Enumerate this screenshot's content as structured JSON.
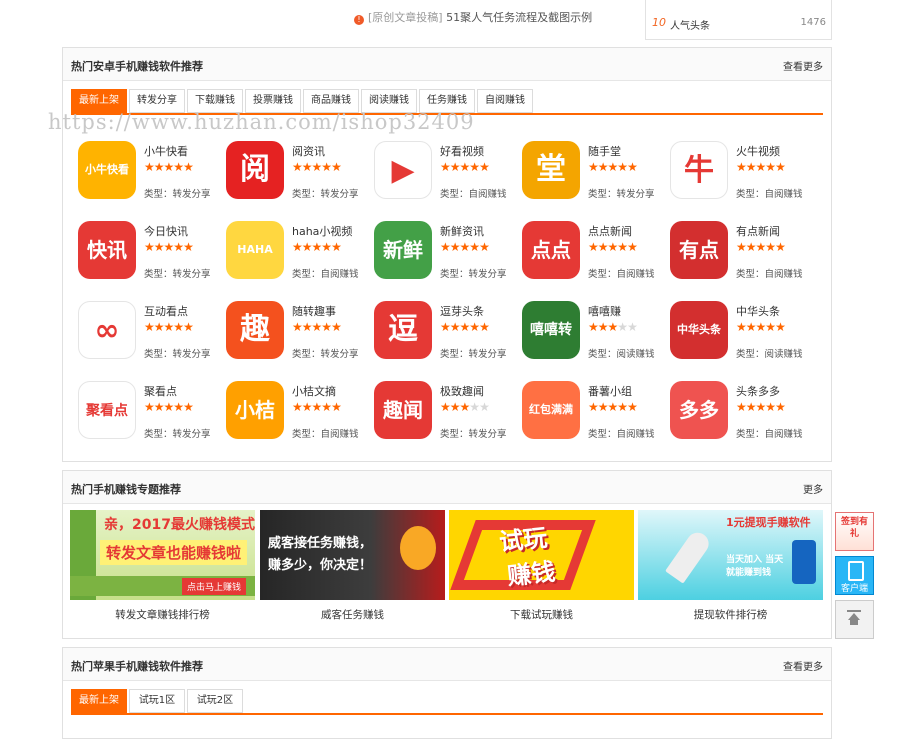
{
  "top": {
    "article_icon": "info-icon",
    "article_tag": "[原创文章投稿]",
    "article_title": "51聚人气任务流程及截图示例",
    "rank_num": "10",
    "rank_label": "人气头条",
    "rank_count": "1476"
  },
  "watermark": "https://www.huzhan.com/ishop32409",
  "android": {
    "title": "热门安卓手机赚钱软件推荐",
    "more": "查看更多",
    "tabs": [
      "最新上架",
      "转发分享",
      "下载赚钱",
      "投票赚钱",
      "商品赚钱",
      "阅读赚钱",
      "任务赚钱",
      "自阅赚钱"
    ],
    "apps": [
      {
        "name": "小牛快看",
        "rating": 5,
        "type": "类型：转发分享",
        "icon_text": "小牛快看",
        "color": "#ffb300"
      },
      {
        "name": "阅资讯",
        "rating": 5,
        "type": "类型：转发分享",
        "icon_text": "阅",
        "color": "#e52222"
      },
      {
        "name": "好看视频",
        "rating": 5,
        "type": "类型：自阅赚钱",
        "icon_text": "▶",
        "color": "#ffffff"
      },
      {
        "name": "随手堂",
        "rating": 5,
        "type": "类型：转发分享",
        "icon_text": "堂",
        "color": "#f4a500"
      },
      {
        "name": "火牛视频",
        "rating": 5,
        "type": "类型：自阅赚钱",
        "icon_text": "牛",
        "color": "#ffffff"
      },
      {
        "name": "今日快讯",
        "rating": 5,
        "type": "类型：转发分享",
        "icon_text": "快讯",
        "color": "#e53935"
      },
      {
        "name": "haha小视频",
        "rating": 5,
        "type": "类型：自阅赚钱",
        "icon_text": "HAHA",
        "color": "#ffd740"
      },
      {
        "name": "新鲜资讯",
        "rating": 5,
        "type": "类型：转发分享",
        "icon_text": "新鲜",
        "color": "#43a047"
      },
      {
        "name": "点点新闻",
        "rating": 5,
        "type": "类型：自阅赚钱",
        "icon_text": "点点",
        "color": "#e53935"
      },
      {
        "name": "有点新闻",
        "rating": 5,
        "type": "类型：自阅赚钱",
        "icon_text": "有点",
        "color": "#d32f2f"
      },
      {
        "name": "互动看点",
        "rating": 5,
        "type": "类型：转发分享",
        "icon_text": "∞",
        "color": "#ffffff"
      },
      {
        "name": "随转趣事",
        "rating": 5,
        "type": "类型：转发分享",
        "icon_text": "趣",
        "color": "#f4511e"
      },
      {
        "name": "逗芽头条",
        "rating": 5,
        "type": "类型：转发分享",
        "icon_text": "逗",
        "color": "#e53935"
      },
      {
        "name": "嘻嘻赚",
        "rating": 3,
        "type": "类型：阅读赚钱",
        "icon_text": "嘻嘻转",
        "color": "#2e7d32"
      },
      {
        "name": "中华头条",
        "rating": 5,
        "type": "类型：阅读赚钱",
        "icon_text": "中华头条",
        "color": "#d32f2f"
      },
      {
        "name": "聚看点",
        "rating": 5,
        "type": "类型：转发分享",
        "icon_text": "聚看点",
        "color": "#ffffff"
      },
      {
        "name": "小桔文摘",
        "rating": 5,
        "type": "类型：自阅赚钱",
        "icon_text": "小桔",
        "color": "#ffa000"
      },
      {
        "name": "极致趣闻",
        "rating": 3,
        "type": "类型：转发分享",
        "icon_text": "趣闻",
        "color": "#e53935"
      },
      {
        "name": "番薯小组",
        "rating": 5,
        "type": "类型：自阅赚钱",
        "icon_text": "红包满满",
        "color": "#ff7043"
      },
      {
        "name": "头条多多",
        "rating": 5,
        "type": "类型：自阅赚钱",
        "icon_text": "多多",
        "color": "#ef5350"
      }
    ]
  },
  "topics": {
    "title": "热门手机赚钱专题推荐",
    "more": "更多",
    "items": [
      {
        "caption": "转发文章赚钱排行榜",
        "text1": "亲，2017最火赚钱模式！",
        "text2": "转发文章也能赚钱啦",
        "cta": "点击马上赚钱"
      },
      {
        "caption": "威客任务赚钱",
        "text1": "威客接任务赚钱，",
        "text2": "赚多少，你决定！"
      },
      {
        "caption": "下载试玩赚钱",
        "text1": "试玩",
        "text2": "赚钱"
      },
      {
        "caption": "提现软件排行榜",
        "text1": "1元提现手赚软件",
        "text2": "当天加入 当天就能赚到钱"
      }
    ]
  },
  "apple": {
    "title": "热门苹果手机赚钱软件推荐",
    "more": "查看更多",
    "tabs": [
      "最新上架",
      "试玩1区",
      "试玩2区"
    ]
  },
  "float": {
    "signin": "签到有礼",
    "client": "客户端",
    "top_icon": "arrow-up-icon"
  },
  "colors": {
    "accent": "#ff6600",
    "star_on": "#ff6600",
    "star_off": "#d8d8d8"
  }
}
